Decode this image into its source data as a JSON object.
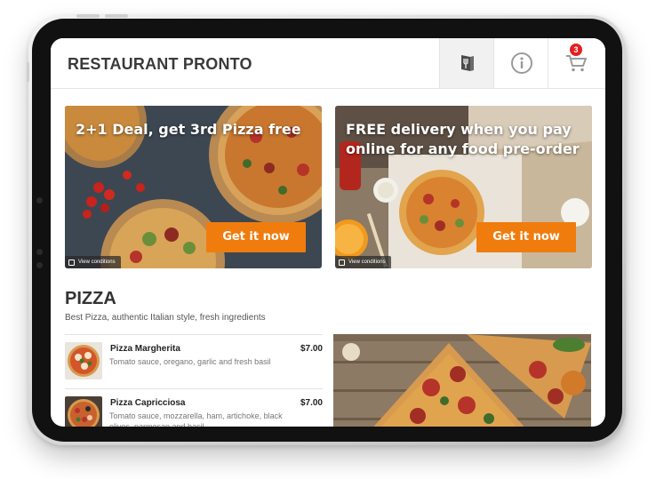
{
  "app": {
    "title": "RESTAURANT PRONTO",
    "cart_count": "3"
  },
  "header": {
    "icons": [
      "menu-book-icon",
      "info-icon",
      "cart-icon"
    ],
    "accent_color": "#e32020"
  },
  "banners": [
    {
      "title": "2+1 Deal, get 3rd Pizza free",
      "cta": "Get it now",
      "conditions": "View conditions"
    },
    {
      "title": "FREE delivery when you pay online for any food pre-order",
      "cta": "Get it now",
      "conditions": "View conditions"
    }
  ],
  "cta_color": "#f07c0e",
  "section": {
    "title": "PIZZA",
    "subtitle": "Best Pizza, authentic Italian style, fresh ingredients"
  },
  "items": [
    {
      "name": "Pizza Margherita",
      "description": "Tomato sauce, oregano, garlic and fresh basil",
      "price": "$7.00"
    },
    {
      "name": "Pizza Capricciosa",
      "description": "Tomato sauce, mozzarella, ham, artichoke, black olives, parmesan and basil",
      "price": "$7.00"
    }
  ]
}
